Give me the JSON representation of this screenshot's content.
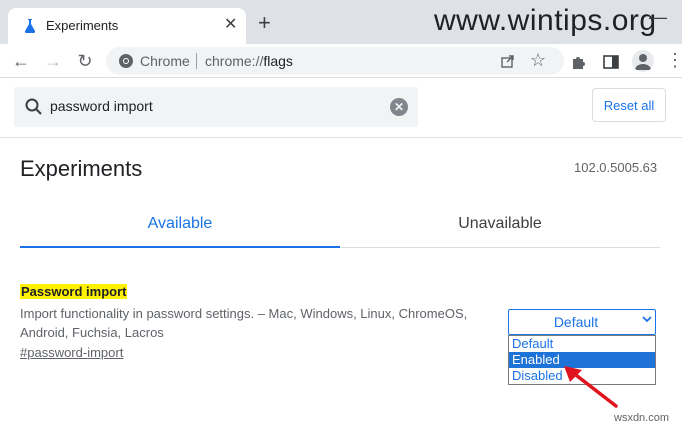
{
  "browser": {
    "tab_title": "Experiments",
    "tab_close": "✕",
    "new_tab": "+",
    "watermark": "www.wintips.org",
    "minimize": "—",
    "omnibox_chrome_label": "Chrome",
    "omnibox_url_scheme": "chrome://",
    "omnibox_url_path": "flags"
  },
  "search": {
    "value": "password import",
    "reset_label": "Reset all"
  },
  "page": {
    "title": "Experiments",
    "version": "102.0.5005.63",
    "tabs": [
      {
        "label": "Available"
      },
      {
        "label": "Unavailable"
      }
    ]
  },
  "experiment": {
    "title": "Password import",
    "description": "Import functionality in password settings. – Mac, Windows, Linux, ChromeOS, Android, Fuchsia, Lacros",
    "link": "#password-import",
    "selected": "Default",
    "options": [
      "Default",
      "Enabled",
      "Disabled"
    ],
    "highlighted_option": "Enabled"
  },
  "footer_watermark": "wsxdn.com",
  "colors": {
    "accent": "#1a73e8",
    "highlight": "#fff200",
    "selection": "#1e73d8",
    "arrow": "#e0141e"
  }
}
